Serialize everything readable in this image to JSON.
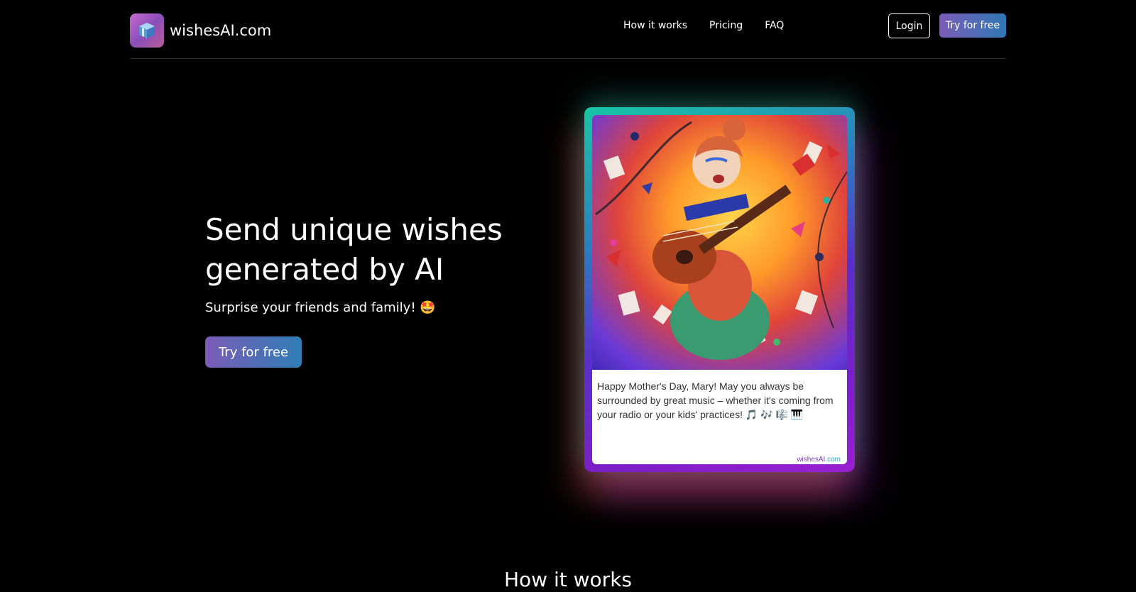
{
  "brand": {
    "name": "wishesAI.com",
    "logo_icon": "gift-box-icon"
  },
  "nav": {
    "items": [
      {
        "label": "How it works"
      },
      {
        "label": "Pricing"
      },
      {
        "label": "FAQ"
      }
    ],
    "login_label": "Login",
    "try_label": "Try for free"
  },
  "hero": {
    "title": "Send unique wishes generated by AI",
    "subtitle": "Surprise your friends and family! 🤩",
    "cta_label": "Try for free"
  },
  "card": {
    "message": "Happy Mother's Day, Mary! May you always be surrounded by great music – whether it's coming from your radio or your kids' practices! 🎵 🎶 🎼 🎹",
    "brand_part1": "wishesAI",
    "brand_part2": ".com",
    "image": "mother-playing-guitar-illustration"
  },
  "sections": {
    "how_it_works_title": "How it works"
  },
  "colors": {
    "background": "#000000",
    "gradient_start": "#7b5cb8",
    "gradient_end": "#2f79b6"
  }
}
